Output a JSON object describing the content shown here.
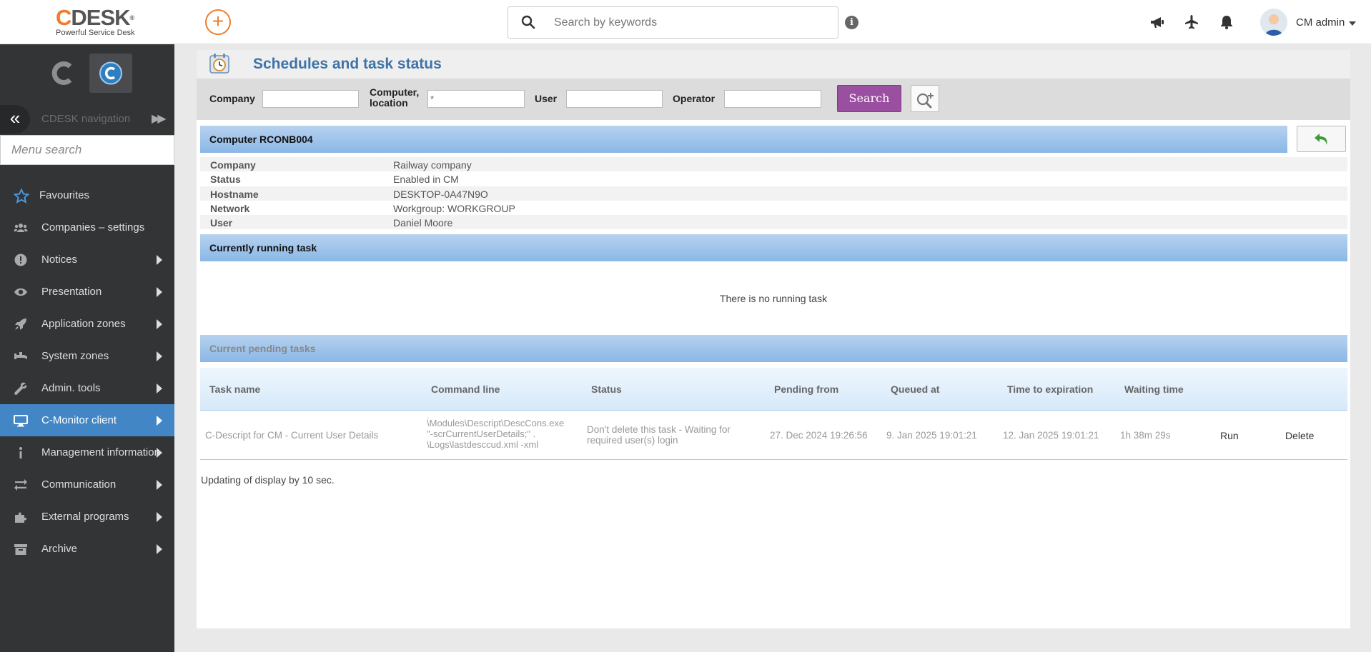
{
  "header": {
    "logo_text": "CDESK",
    "logo_tagline": "Powerful Service Desk",
    "add_label": "+",
    "search_placeholder": "Search by keywords",
    "user_name": "CM admin"
  },
  "sidebar": {
    "nav_title": "CDESK navigation",
    "menu_search_placeholder": "Menu search",
    "items": [
      {
        "label": "Favourites",
        "icon": "star-icon",
        "has_submenu": false,
        "active": false
      },
      {
        "label": "Companies – settings",
        "icon": "users-icon",
        "has_submenu": false,
        "active": false
      },
      {
        "label": "Notices",
        "icon": "exclamation-icon",
        "has_submenu": true,
        "active": false
      },
      {
        "label": "Presentation",
        "icon": "eye-icon",
        "has_submenu": true,
        "active": false
      },
      {
        "label": "Application zones",
        "icon": "rocket-icon",
        "has_submenu": true,
        "active": false
      },
      {
        "label": "System zones",
        "icon": "faucet-icon",
        "has_submenu": true,
        "active": false
      },
      {
        "label": "Admin. tools",
        "icon": "wrench-icon",
        "has_submenu": true,
        "active": false
      },
      {
        "label": "C-Monitor client",
        "icon": "monitor-icon",
        "has_submenu": true,
        "active": true
      },
      {
        "label": "Management information",
        "icon": "info-icon",
        "has_submenu": true,
        "active": false
      },
      {
        "label": "Communication",
        "icon": "exchange-icon",
        "has_submenu": true,
        "active": false
      },
      {
        "label": "External programs",
        "icon": "puzzle-icon",
        "has_submenu": true,
        "active": false
      },
      {
        "label": "Archive",
        "icon": "archive-icon",
        "has_submenu": true,
        "active": false
      }
    ]
  },
  "page": {
    "title": "Schedules and task status",
    "filters": {
      "company_label": "Company",
      "company_value": "",
      "computer_label_1": "Computer,",
      "computer_label_2": "location",
      "computer_value": "*",
      "user_label": "User",
      "user_value": "",
      "operator_label": "Operator",
      "operator_value": "",
      "search_button": "Search"
    },
    "computer_section": {
      "title": "Computer RCONB004",
      "fields": [
        {
          "key": "Company",
          "value": "Railway company"
        },
        {
          "key": "Status",
          "value": "Enabled in CM"
        },
        {
          "key": "Hostname",
          "value": "DESKTOP-0A47N9O"
        },
        {
          "key": "Network",
          "value": "Workgroup: WORKGROUP"
        },
        {
          "key": "User",
          "value": "Daniel Moore"
        }
      ]
    },
    "running_section": {
      "title": "Currently running task",
      "empty_text": "There is no running task"
    },
    "pending_section": {
      "title": "Current pending tasks",
      "columns": [
        "Task name",
        "Command line",
        "Status",
        "Pending from",
        "Queued at",
        "Time to expiration",
        "Waiting time"
      ],
      "rows": [
        {
          "task_name": "C-Descript for CM - Current User Details",
          "command_line": [
            "\\Modules\\Descript\\DescCons.exe",
            "\"-scrCurrentUserDetails;\" .",
            "\\Logs\\lastdesccud.xml -xml"
          ],
          "status": [
            "Don't delete this task - Waiting for",
            "required user(s) login"
          ],
          "pending_from": "27. Dec 2024 19:26:56",
          "queued_at": "9. Jan 2025 19:01:21",
          "time_to_expiration": "12. Jan 2025 19:01:21",
          "waiting_time": "1h 38m 29s",
          "action_run": "Run",
          "action_delete": "Delete"
        }
      ]
    },
    "refresh_note": "Updating of display by 10 sec."
  },
  "colors": {
    "brand_orange": "#f07c2b",
    "sidebar_bg": "#333436",
    "active_item": "#4386c6",
    "title_blue": "#3f74a8",
    "search_button": "#9b4fa0"
  }
}
